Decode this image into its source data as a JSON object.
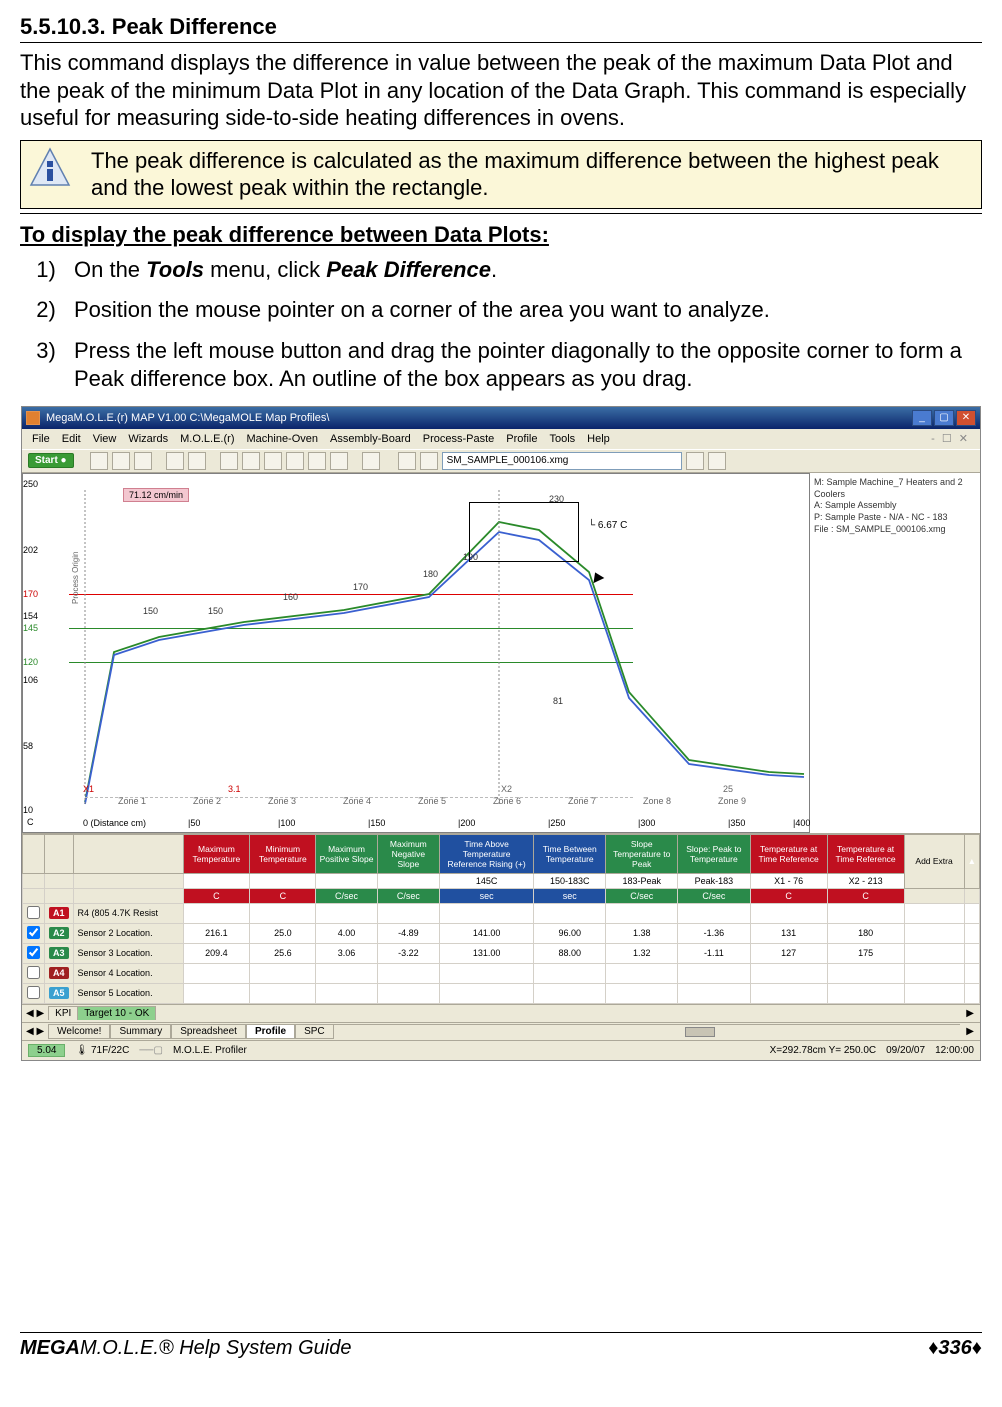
{
  "doc": {
    "section_number": "5.5.10.3.",
    "section_title": "Peak Difference",
    "intro": "This command displays the difference in value between the peak of the maximum Data Plot and the peak of the minimum Data Plot in any location of the Data Graph. This command is especially useful for measuring side-to-side heating differences in ovens.",
    "note": "The peak difference is calculated as the maximum difference between the highest peak and the lowest peak within the rectangle.",
    "sub_heading": "To display the peak difference between Data Plots:",
    "steps": [
      {
        "pre": "On the ",
        "bi1": "Tools",
        "mid": " menu, click ",
        "bi2": "Peak Difference",
        "post": "."
      },
      {
        "text": "Position the mouse pointer on a corner of the area you want to analyze."
      },
      {
        "text": "Press the left mouse button and drag the pointer diagonally to the opposite corner to form a Peak difference box. An outline of the box appears as you drag."
      }
    ],
    "footer_left_bold": "MEGA",
    "footer_left_rest": "M.O.L.E.® Help System Guide",
    "footer_page": "336"
  },
  "app": {
    "title": "MegaM.O.L.E.(r) MAP V1.00    C:\\MegaMOLE Map Profiles\\",
    "menus": [
      "File",
      "Edit",
      "View",
      "Wizards",
      "M.O.L.E.(r)",
      "Machine-Oven",
      "Assembly-Board",
      "Process-Paste",
      "Profile",
      "Tools",
      "Help"
    ],
    "start_label": "Start ●",
    "file_combo": "SM_SAMPLE_000106.xmg",
    "side_info": [
      "M: Sample Machine_7 Heaters and 2 Coolers",
      "A: Sample Assembly",
      "P: Sample Paste - N/A - NC - 183",
      "File : SM_SAMPLE_000106.xmg"
    ]
  },
  "chart_data": {
    "type": "line",
    "xlabel": "0 (Distance cm)",
    "ylabel": "C",
    "ylim": [
      10,
      250
    ],
    "y_ticks": [
      250.0,
      202.0,
      170.0,
      154.0,
      145.0,
      120.0,
      106.0,
      58.0,
      10.0
    ],
    "y_tick_colors": {
      "170.00": "red",
      "145.00": "green",
      "120.00": "green"
    },
    "x_ticks": [
      0,
      50,
      100,
      150,
      200,
      250,
      300,
      350,
      400
    ],
    "ref_lines": [
      {
        "y": 170,
        "color": "red"
      },
      {
        "y": 145,
        "color": "green"
      },
      {
        "y": 120,
        "color": "green"
      }
    ],
    "speed_badge": "71.12 cm/min",
    "zones": [
      "Zone 1",
      "Zone 2",
      "Zone 3",
      "Zone 4",
      "Zone 5",
      "Zone 6",
      "Zone 7",
      "Zone 8",
      "Zone 9"
    ],
    "zone_top_values": [
      150,
      150,
      160,
      170,
      180,
      190,
      230,
      null,
      null
    ],
    "zone_bot_small": {
      "over_zone2": "3.1",
      "over_zone9_top": "25"
    },
    "x_markers": {
      "X1": 0,
      "X2": 235
    },
    "peak_box": {
      "x1_cm": 215,
      "x2_cm": 255,
      "y_top": 235,
      "y_bot": 185,
      "delta_label": "6.67 C"
    },
    "midline_value": 81,
    "series": [
      {
        "name": "Sensor 2",
        "color": "#2a8a2a",
        "approx": [
          [
            10,
            20
          ],
          [
            50,
            150
          ],
          [
            150,
            175
          ],
          [
            200,
            195
          ],
          [
            235,
            230
          ],
          [
            260,
            220
          ],
          [
            300,
            100
          ],
          [
            360,
            50
          ],
          [
            400,
            45
          ]
        ]
      },
      {
        "name": "Sensor 3",
        "color": "#3a60d0",
        "approx": [
          [
            10,
            18
          ],
          [
            50,
            148
          ],
          [
            150,
            172
          ],
          [
            200,
            192
          ],
          [
            235,
            224
          ],
          [
            260,
            215
          ],
          [
            300,
            95
          ],
          [
            360,
            48
          ],
          [
            400,
            44
          ]
        ]
      }
    ]
  },
  "grid": {
    "headers": [
      {
        "label": "Maximum Temperature",
        "cls": "th-red"
      },
      {
        "label": "Minimum Temperature",
        "cls": "th-red"
      },
      {
        "label": "Maximum Positive Slope",
        "cls": "th-grn"
      },
      {
        "label": "Maximum Negative Slope",
        "cls": "th-grn"
      },
      {
        "label": "Time Above Temperature Reference Rising (+)",
        "cls": "th-blu"
      },
      {
        "label": "Time Between Temperature",
        "cls": "th-blu"
      },
      {
        "label": "Slope Temperature to Peak",
        "cls": "th-grn"
      },
      {
        "label": "Slope: Peak to Temperature",
        "cls": "th-grn"
      },
      {
        "label": "Temperature at Time Reference",
        "cls": "th-red"
      },
      {
        "label": "Temperature at Time Reference",
        "cls": "th-red"
      }
    ],
    "header2": [
      "",
      "",
      "",
      "",
      "145C",
      "150-183C",
      "183-Peak",
      "Peak-183",
      "X1 - 76",
      "X2 - 213"
    ],
    "units_row": [
      {
        "v": "C",
        "cls": "unit-cell-red"
      },
      {
        "v": "C",
        "cls": "unit-cell-red"
      },
      {
        "v": "C/sec",
        "cls": "unit-cell-grn"
      },
      {
        "v": "C/sec",
        "cls": "unit-cell-grn"
      },
      {
        "v": "sec",
        "cls": "unit-cell-blu"
      },
      {
        "v": "sec",
        "cls": "unit-cell-blu"
      },
      {
        "v": "C/sec",
        "cls": "unit-cell-grn"
      },
      {
        "v": "C/sec",
        "cls": "unit-cell-grn"
      },
      {
        "v": "C",
        "cls": "unit-cell-red"
      },
      {
        "v": "C",
        "cls": "unit-cell-red"
      }
    ],
    "rows": [
      {
        "hdr": "A1",
        "hcls": "rh-red",
        "label": "R4 (805 4.7K Resist",
        "vals": [
          "",
          "",
          "",
          "",
          "",
          "",
          "",
          "",
          "",
          ""
        ]
      },
      {
        "hdr": "A2",
        "hcls": "rh-grn",
        "label": "Sensor 2 Location.",
        "vals": [
          "216.1",
          "25.0",
          "4.00",
          "-4.89",
          "141.00",
          "96.00",
          "1.38",
          "-1.36",
          "131",
          "180"
        ]
      },
      {
        "hdr": "A3",
        "hcls": "rh-grn",
        "label": "Sensor 3 Location.",
        "vals": [
          "209.4",
          "25.6",
          "3.06",
          "-3.22",
          "131.00",
          "88.00",
          "1.32",
          "-1.11",
          "127",
          "175"
        ]
      },
      {
        "hdr": "A4",
        "hcls": "rh-dred",
        "label": "Sensor 4 Location.",
        "vals": [
          "",
          "",
          "",
          "",
          "",
          "",
          "",
          "",
          "",
          ""
        ]
      },
      {
        "hdr": "A5",
        "hcls": "rh-cyn",
        "label": "Sensor 5 Location.",
        "vals": [
          "",
          "",
          "",
          "",
          "",
          "",
          "",
          "",
          "",
          ""
        ]
      }
    ],
    "add_extra": "Add Extra",
    "kpi_tabs": [
      "KPI",
      "Target 10 - OK"
    ],
    "view_tabs": [
      "Welcome!",
      "Summary",
      "Spreadsheet",
      "Profile",
      "SPC"
    ],
    "view_active": "Profile"
  },
  "status": {
    "left_pill": "5.04",
    "temp": "71F/22C",
    "app_name": "M.O.L.E. Profiler",
    "coords": "X=292.78cm Y= 250.0C",
    "date": "09/20/07",
    "time": "12:00:00"
  }
}
